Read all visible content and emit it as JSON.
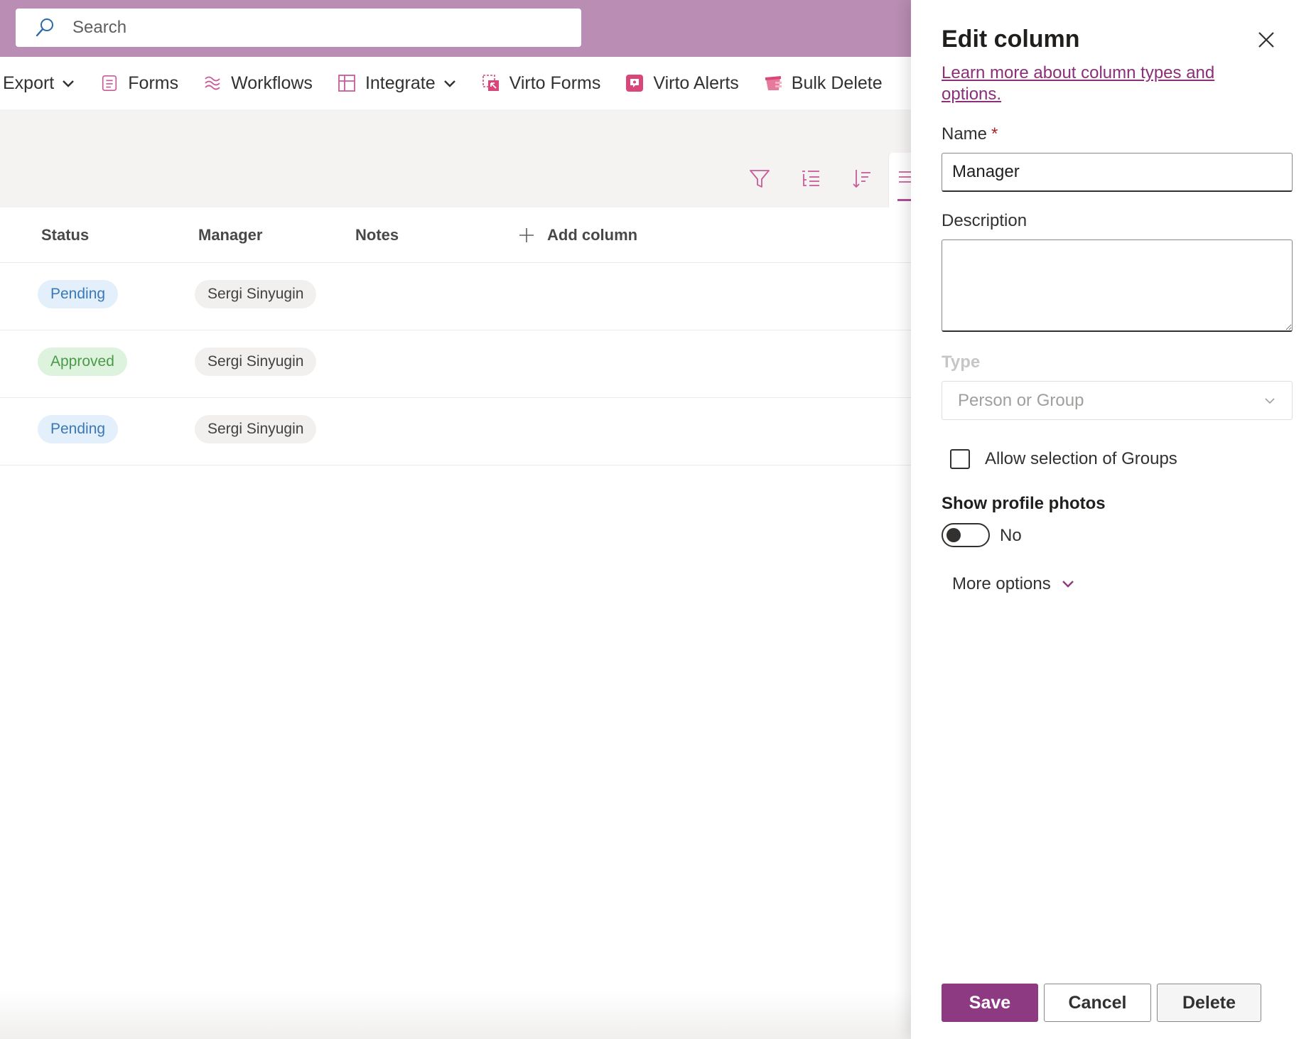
{
  "search": {
    "placeholder": "Search"
  },
  "toolbar": {
    "items": [
      {
        "label": "Export",
        "icon": "export-icon",
        "has_chevron": true
      },
      {
        "label": "Forms",
        "icon": "forms-icon"
      },
      {
        "label": "Workflows",
        "icon": "workflows-icon"
      },
      {
        "label": "Integrate",
        "icon": "integrate-icon",
        "has_chevron": true
      },
      {
        "label": "Virto Forms",
        "icon": "virto-forms-icon"
      },
      {
        "label": "Virto Alerts",
        "icon": "virto-alerts-icon"
      },
      {
        "label": "Bulk Delete",
        "icon": "bulk-delete-icon"
      }
    ]
  },
  "view_icons": [
    "filter-icon",
    "group-icon",
    "sort-icon",
    "view-options-icon"
  ],
  "table": {
    "headers": {
      "status": "Status",
      "manager": "Manager",
      "notes": "Notes",
      "add_column": "Add column"
    },
    "rows": [
      {
        "status": "Pending",
        "manager": "Sergi Sinyugin"
      },
      {
        "status": "Approved",
        "manager": "Sergi Sinyugin"
      },
      {
        "status": "Pending",
        "manager": "Sergi Sinyugin"
      }
    ]
  },
  "panel": {
    "title": "Edit column",
    "learn_link": "Learn more about column types and options.",
    "name_label": "Name",
    "required_mark": "*",
    "name_value": "Manager",
    "description_label": "Description",
    "description_value": "",
    "type_label": "Type",
    "type_value": "Person or Group",
    "allow_groups_label": "Allow selection of Groups",
    "allow_groups_checked": false,
    "show_photos_label": "Show profile photos",
    "show_photos_value": "No",
    "more_options": "More options",
    "save": "Save",
    "cancel": "Cancel",
    "delete": "Delete"
  },
  "colors": {
    "topbar": "#b98db4",
    "accent": "#8e3a82",
    "link": "#8b2f79",
    "icon_pink": "#d9477a",
    "pending_bg": "#e3effa",
    "pending_text": "#3a78b8",
    "approved_bg": "#ddf3dd",
    "approved_text": "#4a9a4a"
  }
}
